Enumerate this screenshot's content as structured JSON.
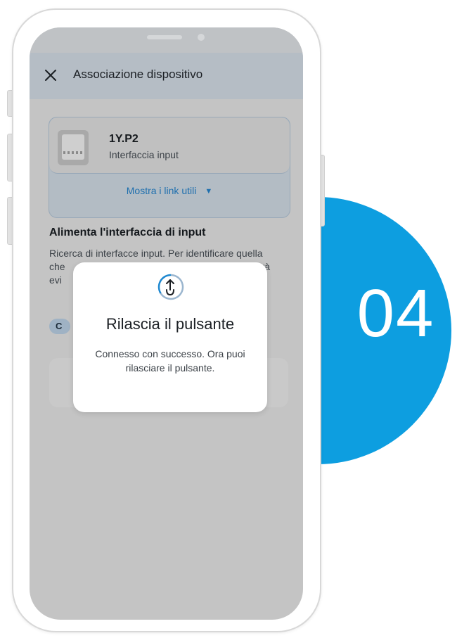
{
  "header": {
    "title": "Associazione dispositivo"
  },
  "device": {
    "name": "1Y.P2",
    "type": "Interfaccia input",
    "links_label": "Mostra i link utili"
  },
  "section": {
    "title": "Alimenta l'interfaccia di input",
    "text_line1": "Ricerca di interfacce input. Per identificare quella",
    "text_line2_start": "che",
    "text_line2_end": "rà",
    "text_line3": "evi",
    "chip_letter": "C"
  },
  "modal": {
    "title": "Rilascia il pulsante",
    "message": "Connesso con successo. Ora puoi rilasciare il pulsante."
  },
  "step": {
    "number": "04"
  },
  "colors": {
    "accent": "#0d9ee0",
    "link": "#1e6fae"
  }
}
